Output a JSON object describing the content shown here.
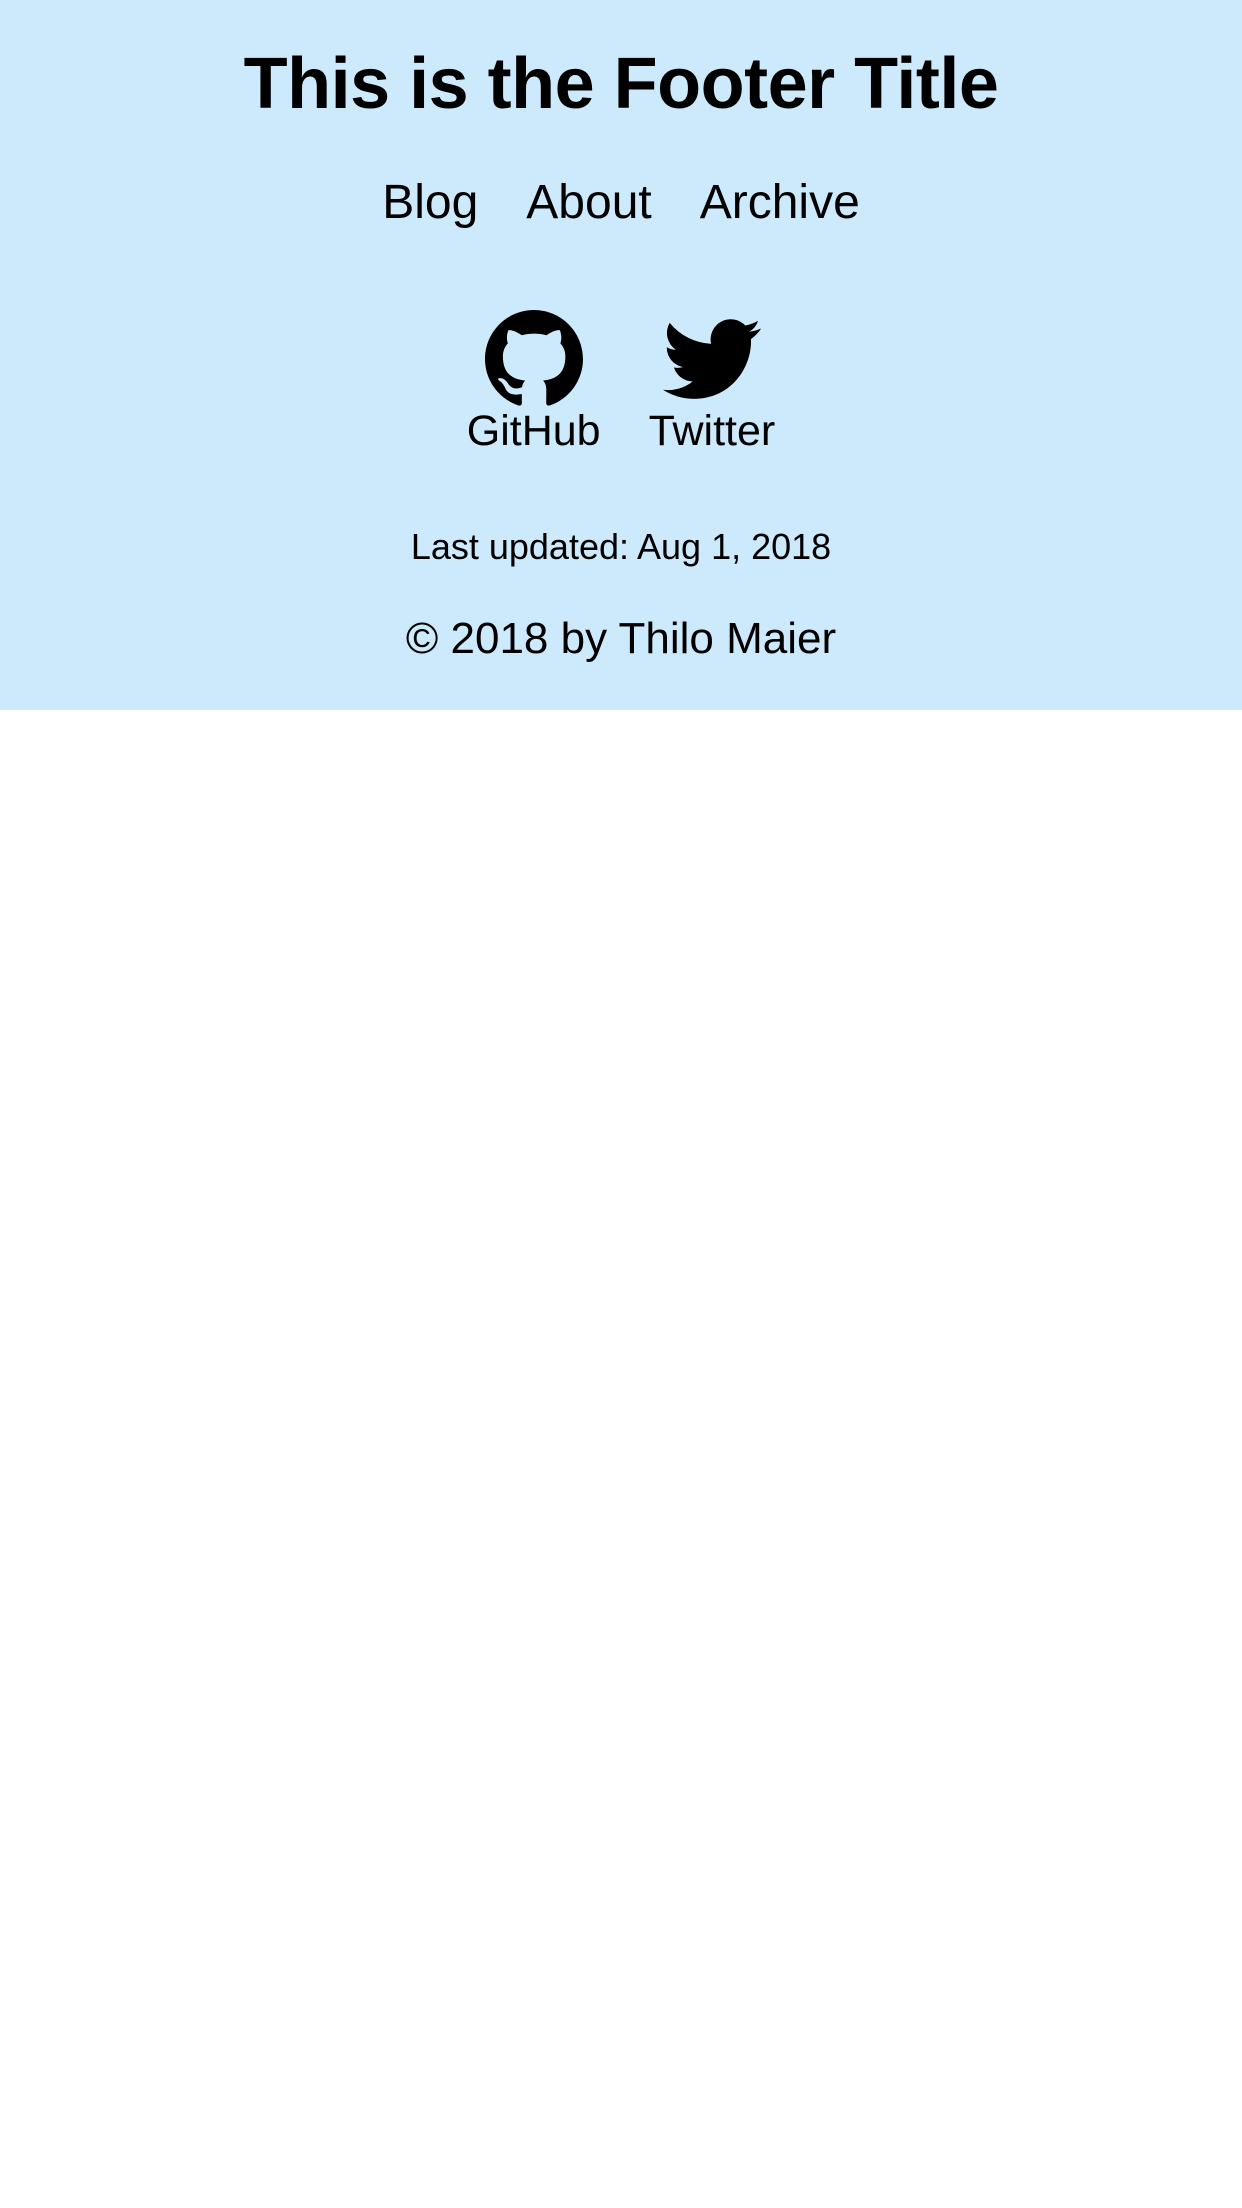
{
  "footer": {
    "title": "This is the Footer Title",
    "background_color": "#cceafc",
    "nav": [
      {
        "label": "Blog"
      },
      {
        "label": "About"
      },
      {
        "label": "Archive"
      }
    ],
    "social": [
      {
        "label": "GitHub",
        "icon": "github-icon"
      },
      {
        "label": "Twitter",
        "icon": "twitter-icon"
      }
    ],
    "last_updated": "Last updated: Aug 1, 2018",
    "copyright": "© 2018 by Thilo Maier"
  }
}
